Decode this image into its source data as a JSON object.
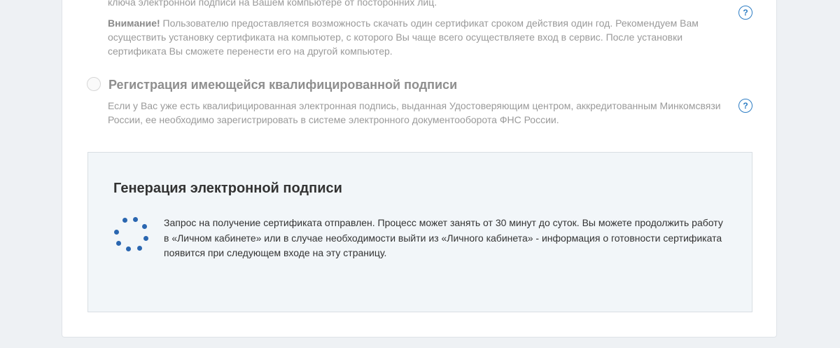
{
  "option1": {
    "partial_line": "ключа электронной подписи на Вашем компьютере от посторонних лиц.",
    "warning_label": "Внимание!",
    "warning_text": " Пользователю предоставляется возможность скачать один сертификат  сроком действия один год. Рекомендуем Вам осуществить установку сертификата на компьютер, с которого Вы  чаще всего осуществляете вход в сервис. После установки сертификата Вы сможете перенести его на другой  компьютер.",
    "help_icon": "?"
  },
  "option2": {
    "title": "Регистрация имеющейся квалифицированной подписи",
    "description": "Если у Вас уже есть квалифицированная электронная подпись, выданная Удостоверяющим центром, аккредитованным Минкомсвязи России, ее необходимо зарегистрировать в системе электронного документооборота ФНС России.",
    "help_icon": "?"
  },
  "generation_panel": {
    "title": "Генерация электронной подписи",
    "message": "Запрос на получение сертификата отправлен. Процесс может занять от 30 минут до суток. Вы можете продолжить работу в «Личном кабинете» или в случае необходимости выйти из «Личного кабинета» - информация о готовности сертификата появится при следующем входе на эту страницу.",
    "spinner_icon": "loading-spinner-icon"
  },
  "colors": {
    "accent": "#2d7dc4",
    "spinner": "#2a66b0",
    "muted_text": "#9a9a9a",
    "panel_bg": "#f2f6f9"
  }
}
